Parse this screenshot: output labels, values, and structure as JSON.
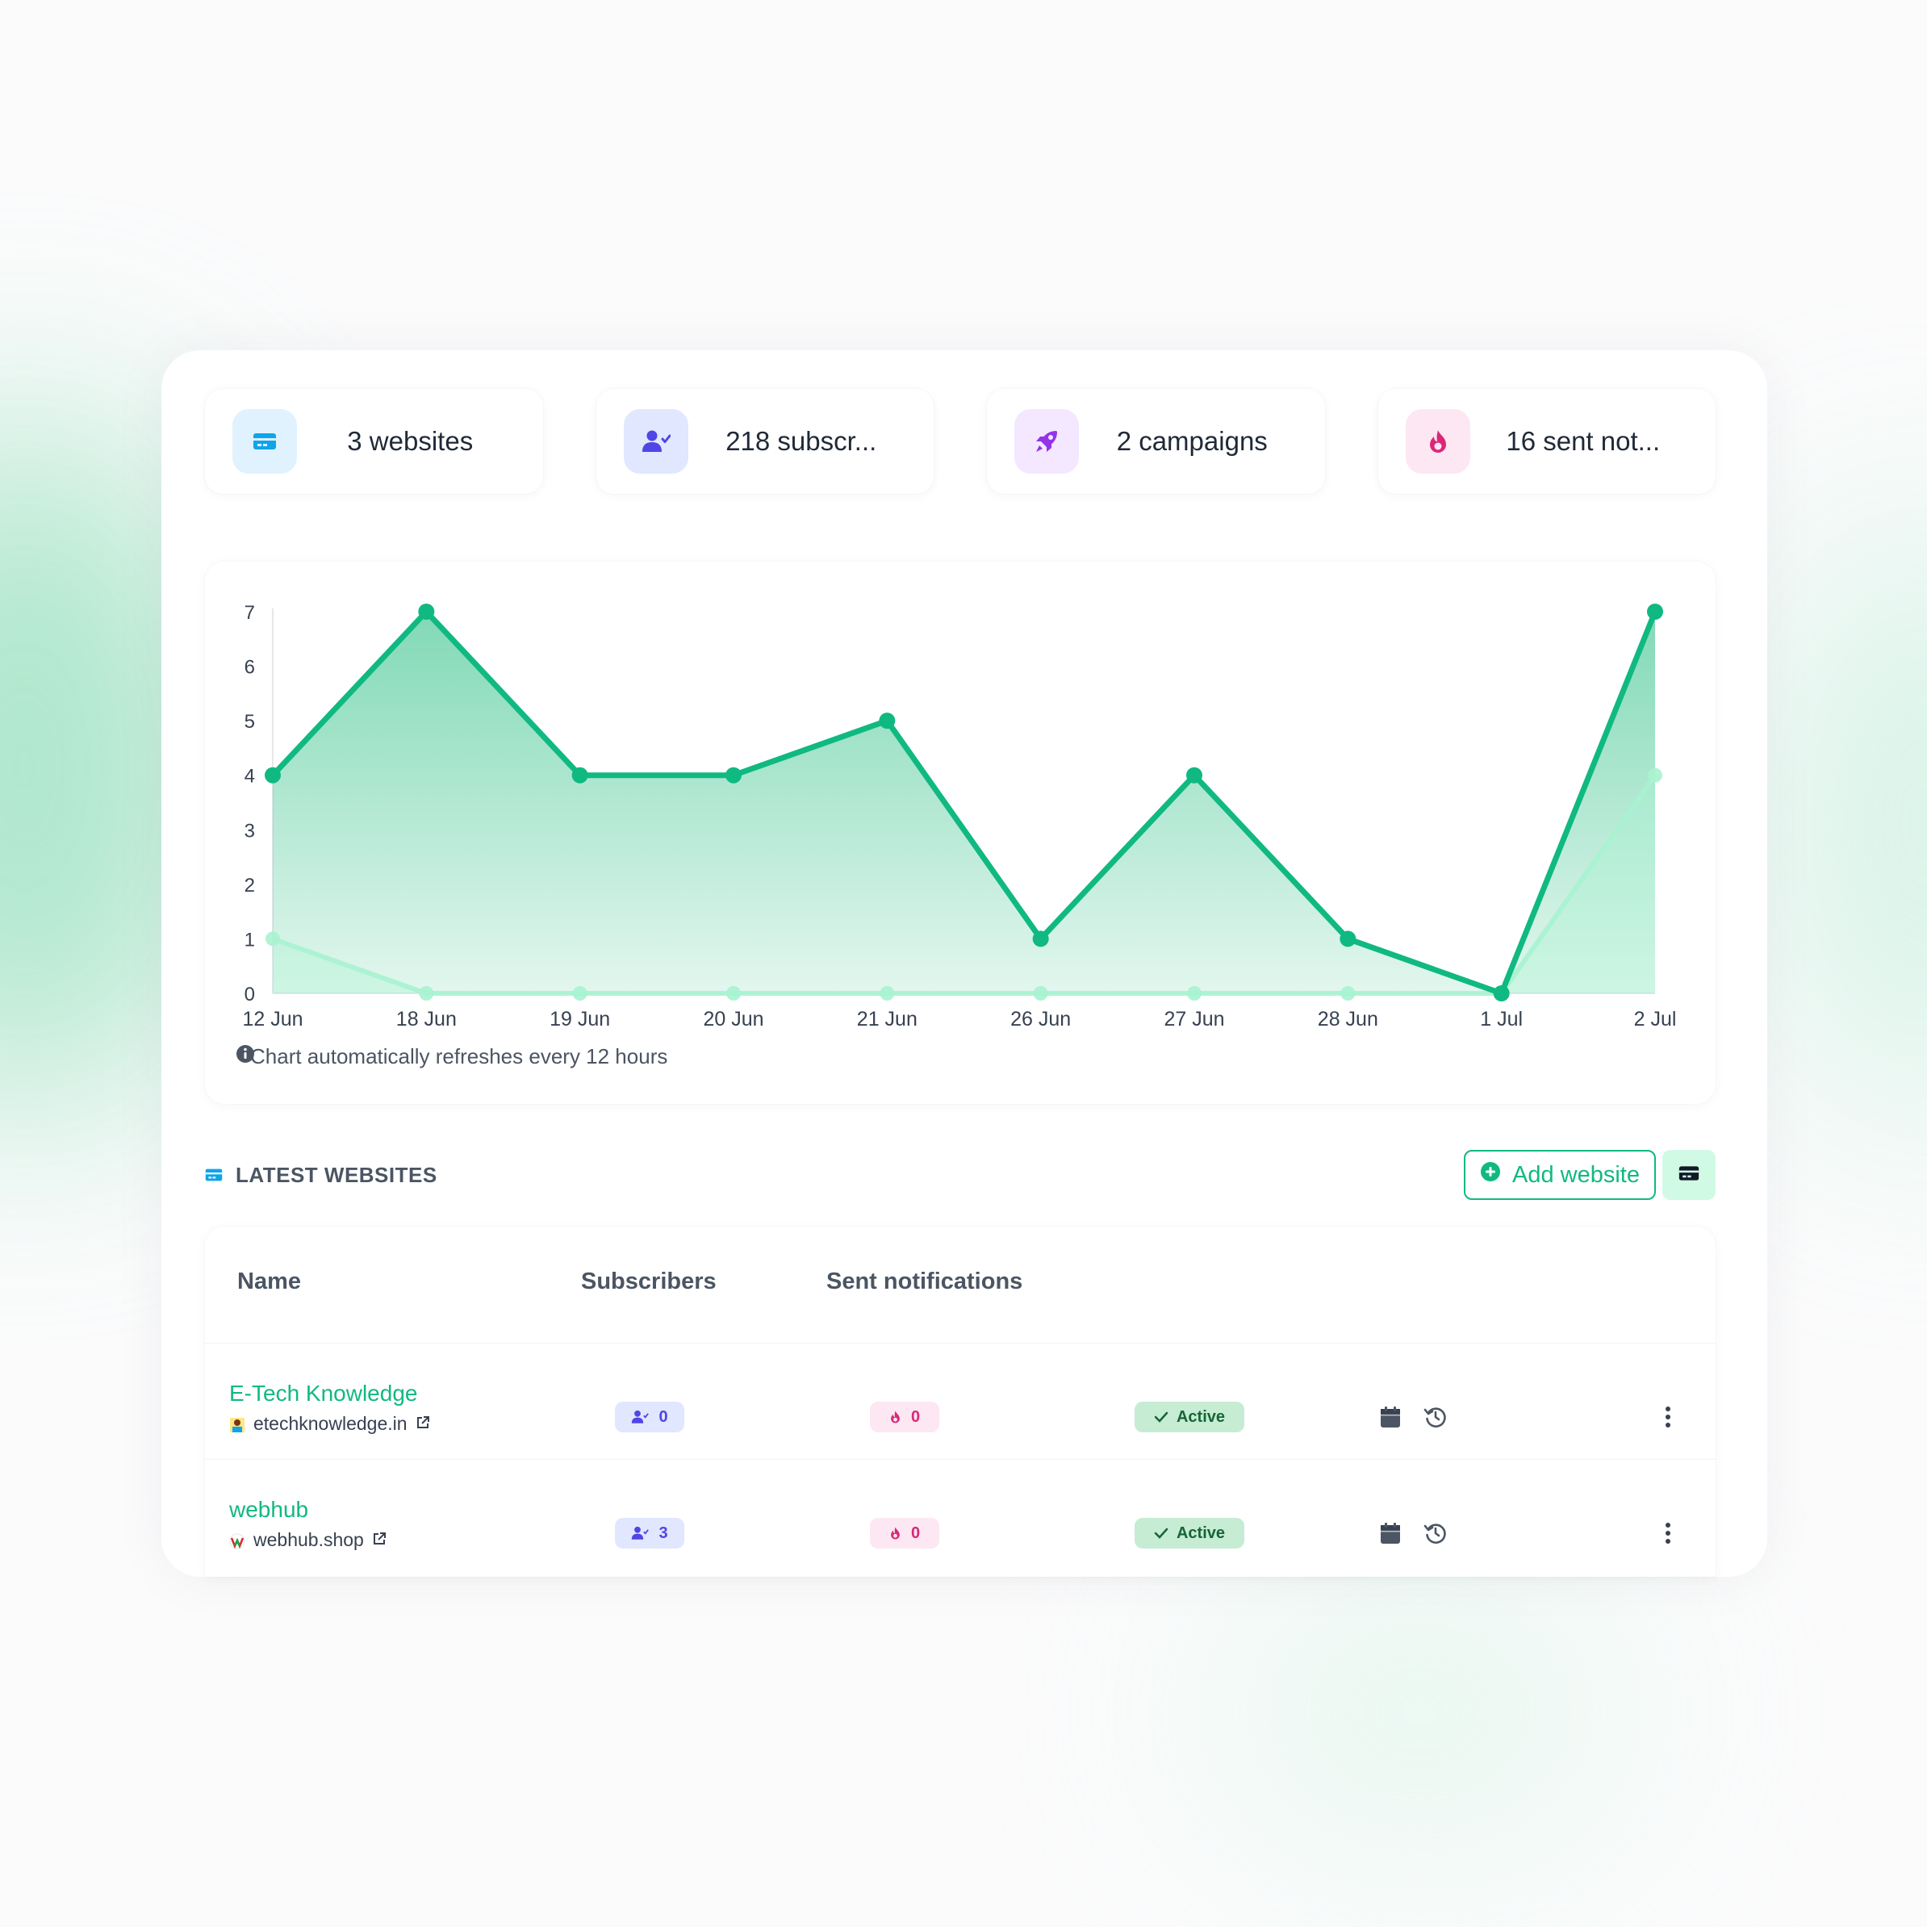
{
  "colors": {
    "accent": "#10b981",
    "accent_light": "#a7f3d0",
    "websites": "#0ea5e9",
    "subscribers": "#4f46e5",
    "campaigns": "#9333ea",
    "sent": "#db2777"
  },
  "stats": [
    {
      "icon": "website-card-icon",
      "text": "3 websites"
    },
    {
      "icon": "user-check-icon",
      "text": "218 subscr..."
    },
    {
      "icon": "rocket-icon",
      "text": "2 campaigns"
    },
    {
      "icon": "fire-icon",
      "text": "16 sent not..."
    }
  ],
  "chart_data": {
    "type": "area",
    "categories": [
      "12 Jun",
      "18 Jun",
      "19 Jun",
      "20 Jun",
      "21 Jun",
      "26 Jun",
      "27 Jun",
      "28 Jun",
      "1 Jul",
      "2 Jul"
    ],
    "series": [
      {
        "values": [
          4,
          7,
          4,
          4,
          5,
          1,
          4,
          1,
          0,
          7
        ]
      },
      {
        "values": [
          1,
          0,
          0,
          0,
          0,
          0,
          0,
          0,
          0,
          4
        ]
      }
    ],
    "yticks": [
      "0",
      "1",
      "2",
      "3",
      "4",
      "5",
      "6",
      "7"
    ],
    "ylim": [
      0,
      7
    ],
    "grid": false,
    "legend": "none"
  },
  "chart_note": "Chart automatically refreshes every 12 hours",
  "latest": {
    "title": "LATEST WEBSITES",
    "add_label": "Add website"
  },
  "table": {
    "headers": {
      "name": "Name",
      "subscribers": "Subscribers",
      "sent": "Sent notifications"
    },
    "rows": [
      {
        "name": "E-Tech Knowledge",
        "url": "etechknowledge.in",
        "subscribers": "0",
        "sent": "0",
        "status": "Active"
      },
      {
        "name": "webhub",
        "url": "webhub.shop",
        "subscribers": "3",
        "sent": "0",
        "status": "Active"
      }
    ]
  }
}
